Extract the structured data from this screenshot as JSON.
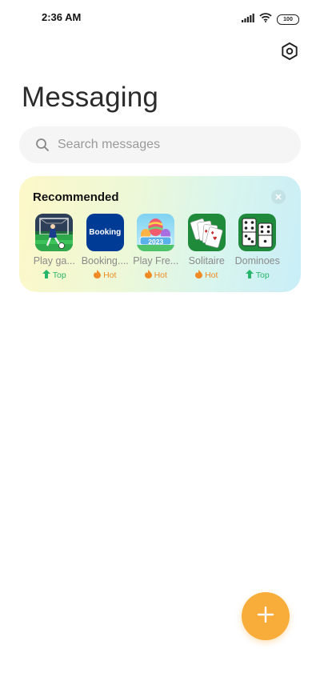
{
  "status_bar": {
    "time": "2:36 AM",
    "battery": "100"
  },
  "header": {
    "title": "Messaging",
    "settings_icon": "gear-hexagon-icon"
  },
  "search": {
    "placeholder": "Search messages"
  },
  "recommended": {
    "title": "Recommended",
    "apps": [
      {
        "name": "Play ga...",
        "badge": "Top",
        "badge_type": "top"
      },
      {
        "name": "Booking....",
        "badge": "Hot",
        "badge_type": "hot",
        "icon_text": "Booking"
      },
      {
        "name": "Play Fre...",
        "badge": "Hot",
        "badge_type": "hot",
        "icon_text": "2023"
      },
      {
        "name": "Solitaire",
        "badge": "Hot",
        "badge_type": "hot"
      },
      {
        "name": "Dominoes",
        "badge": "Top",
        "badge_type": "top"
      }
    ]
  },
  "fab": {
    "icon": "plus-icon",
    "color": "#f8ac3a"
  },
  "colors": {
    "accent": "#f8ac3a",
    "top_green": "#27b56b",
    "hot_orange": "#f08a24"
  }
}
